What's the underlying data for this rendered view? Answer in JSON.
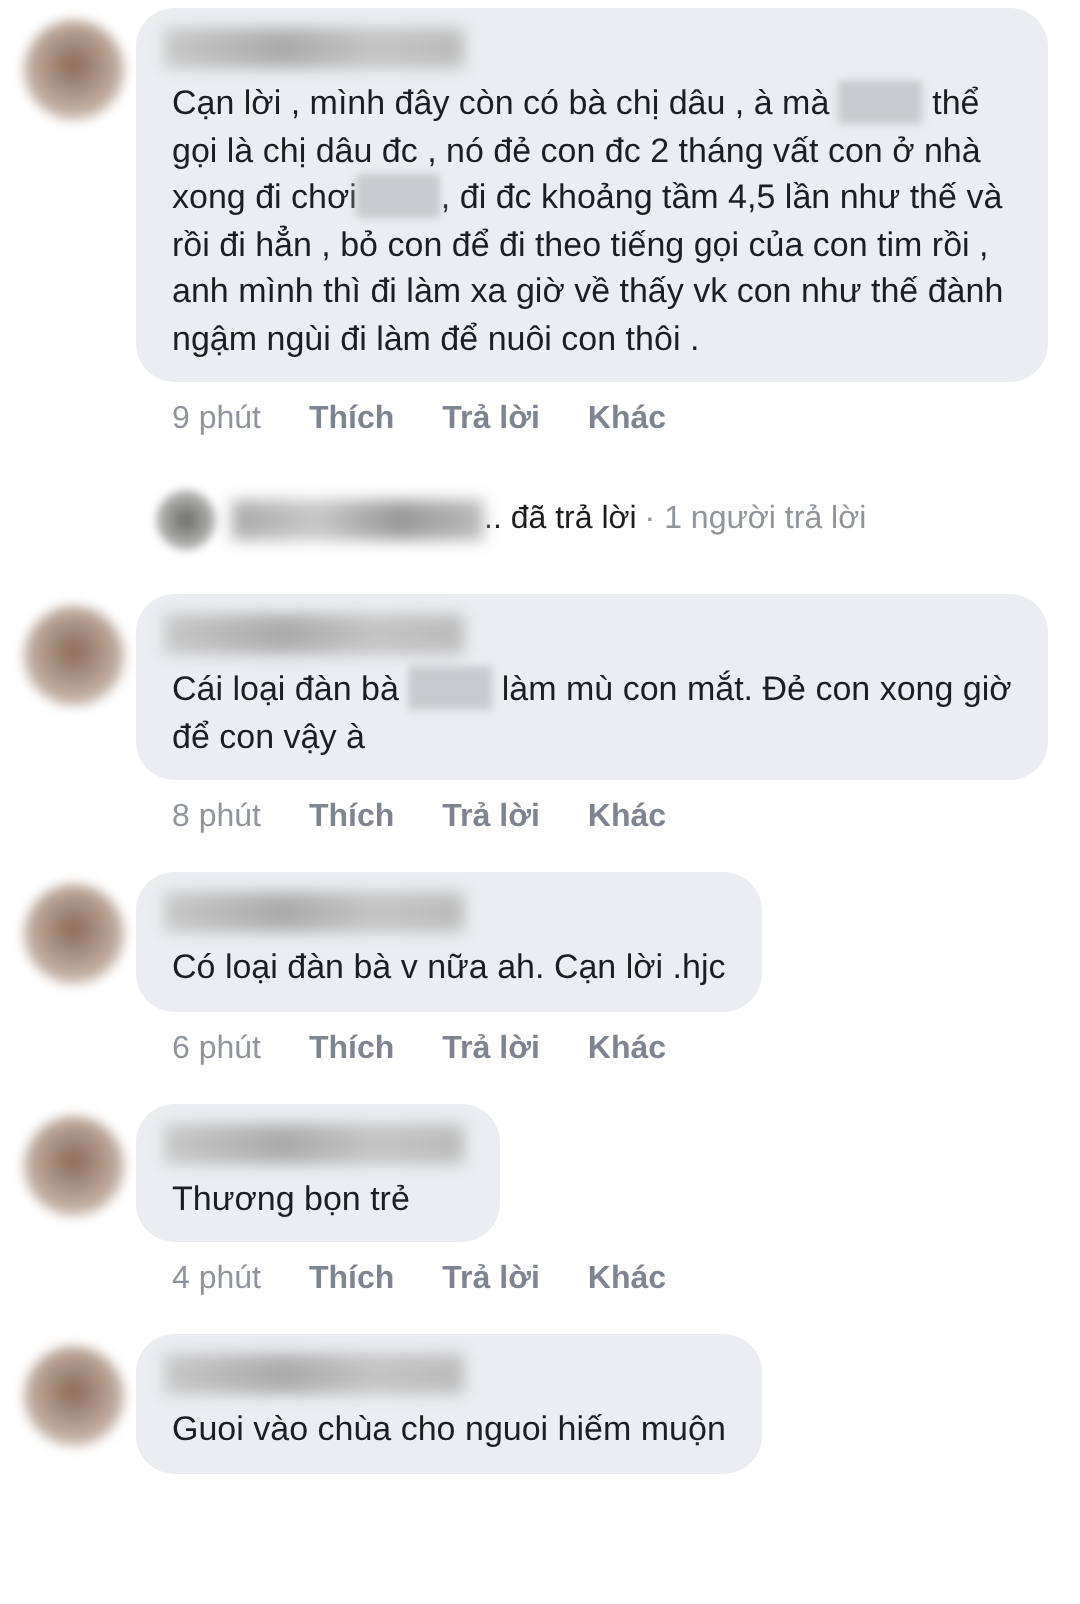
{
  "comments": [
    {
      "text": [
        {
          "kind": "text",
          "text": "Cạn lời , mình đây còn có bà chị dâu , à mà "
        },
        {
          "kind": "blur"
        },
        {
          "kind": "text",
          "text": " thể gọi là chị dâu đc , nó đẻ con đc 2 tháng vất con ở nhà xong đi chơi"
        },
        {
          "kind": "blur"
        },
        {
          "kind": "text",
          "text": ", đi đc khoảng tầm 4,5 lần như thế và rồi đi hẳn , bỏ con để đi theo tiếng gọi của con tim rồi , anh mình thì đi làm xa giờ về thấy vk con như thế đành ngậm ngùi đi làm để nuôi con thôi ."
        }
      ],
      "time": "9 phút",
      "actions": [
        "Thích",
        "Trả lời",
        "Khác"
      ]
    },
    {
      "kind": "reply_summary",
      "replied": ".. đã trả lời",
      "count": "· 1 người trả lời"
    },
    {
      "text": [
        {
          "kind": "text",
          "text": "Cái loại đàn bà "
        },
        {
          "kind": "blur"
        },
        {
          "kind": "text",
          "text": " làm mù con mắt. Đẻ con xong giờ để con vậy à"
        }
      ],
      "time": "8 phút",
      "actions": [
        "Thích",
        "Trả lời",
        "Khác"
      ]
    },
    {
      "text": [
        {
          "kind": "text",
          "text": "Có loại đàn bà v nữa ah. Cạn lời .hjc"
        }
      ],
      "time": "6 phút",
      "actions": [
        "Thích",
        "Trả lời",
        "Khác"
      ]
    },
    {
      "text": [
        {
          "kind": "text",
          "text": "Thương bọn trẻ"
        }
      ],
      "time": "4 phút",
      "actions": [
        "Thích",
        "Trả lời",
        "Khác"
      ]
    },
    {
      "text": [
        {
          "kind": "text",
          "text": "Guoi vào chùa cho nguoi hiếm muộn"
        }
      ]
    }
  ]
}
